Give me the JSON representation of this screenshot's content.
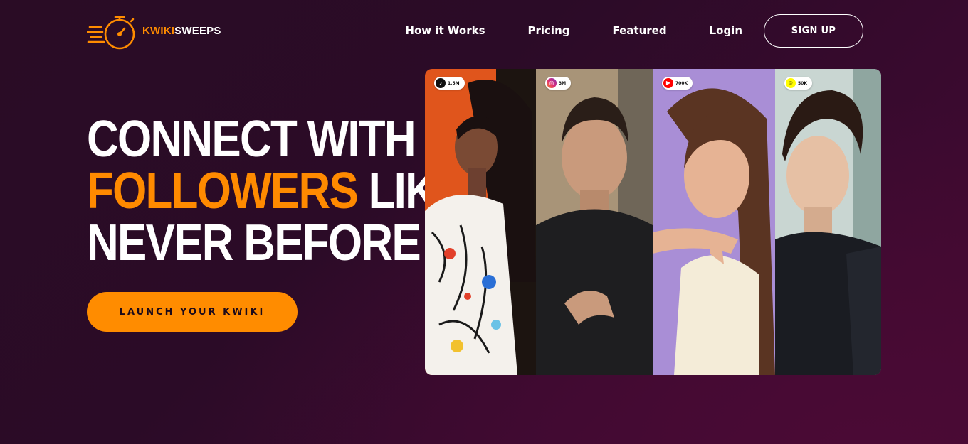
{
  "brand": {
    "name_part1": "KWIKI",
    "name_part2": "SWEEPS",
    "accent_color": "#ff8c00"
  },
  "nav": {
    "items": [
      {
        "label": "How it Works"
      },
      {
        "label": "Pricing"
      },
      {
        "label": "Featured"
      },
      {
        "label": "Login"
      }
    ],
    "signup_label": "SIGN UP"
  },
  "hero": {
    "line1": "CONNECT WITH",
    "line2_accent": "FOLLOWERS",
    "line2_rest": " LIKE",
    "line3": "NEVER BEFORE",
    "cta_label": "LAUNCH YOUR KWIKI"
  },
  "creators": [
    {
      "platform": "tiktok",
      "icon": "tiktok-icon",
      "followers": "1.5M"
    },
    {
      "platform": "instagram",
      "icon": "instagram-icon",
      "followers": "3M"
    },
    {
      "platform": "youtube",
      "icon": "youtube-icon",
      "followers": "700K"
    },
    {
      "platform": "snapchat",
      "icon": "snapchat-icon",
      "followers": "50K"
    }
  ]
}
